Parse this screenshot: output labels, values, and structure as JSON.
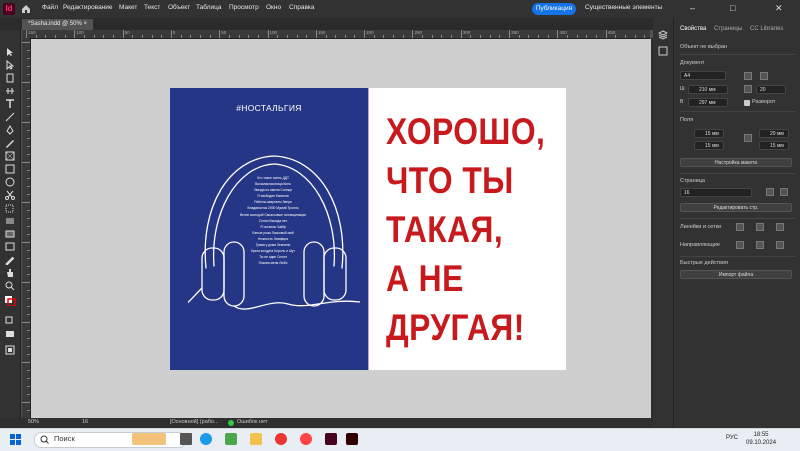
{
  "app": {
    "logo": "Id"
  },
  "menu": [
    "Файл",
    "Редактирование",
    "Макет",
    "Текст",
    "Объект",
    "Таблица",
    "Просмотр",
    "Окно",
    "Справка"
  ],
  "header": {
    "publish": "Публикация",
    "workspace": "Существенные элементы"
  },
  "document": {
    "tab": "*Sasha.indd @ 50%"
  },
  "ruler_labels": [
    "150",
    "100",
    "50",
    "0",
    "50",
    "100",
    "150",
    "200",
    "250",
    "300",
    "350",
    "400",
    "450"
  ],
  "page": {
    "hashtag": "#НОСТАЛЬГИЯ",
    "songs": [
      "Что такое осень ДДТ",
      "Восьмиклассница Кино",
      "Звезда по имени Солнце",
      "Я свободен Кипелов",
      "Районы-кварталы Звери",
      "Владивосток 2000 Мумий Тролль",
      "Вечно молодой Смысловые галлюцинации",
      "Сплин Выхода нет",
      "Я остаюсь Чайф",
      "Белые розы Ласковый май",
      "Нежность Земфира",
      "Трава у дома Земляне",
      "Кукла колдуна Король и Шут",
      "Ты не один Сплин",
      "Позови меня Любэ"
    ],
    "headline": [
      "ХОРОШО,",
      "ЧТО ТЫ",
      "ТАКАЯ,",
      "А НЕ",
      "ДРУГАЯ!"
    ],
    "colors": {
      "left_bg": "#263686",
      "headline": "#c8191d"
    }
  },
  "status": {
    "zoom": "50%",
    "page": "16",
    "state": "[Основной] (рабо...",
    "errors": "Ошибок нет"
  },
  "panel": {
    "tabs": [
      "Свойства",
      "Страницы",
      "CC Libraries"
    ],
    "selection": "Объект не выбран",
    "doc_section": "Документ",
    "preset": "А4",
    "width": "210 мм",
    "height": "297 мм",
    "pages_count": "20",
    "facing": "Разворот",
    "margins_section": "Поля",
    "margin_top": "15 мм",
    "margin_bottom": "15 мм",
    "margin_left": "20 мм",
    "margin_right": "15 мм",
    "layout_btn": "Настройка макета",
    "page_section": "Страница",
    "page_num": "16",
    "edit_page_btn": "Редактировать стр.",
    "guides_section": "Линейки и сетки",
    "align_section": "Направляющие",
    "quick_section": "Быстрые действия",
    "import_btn": "Импорт файла"
  },
  "taskbar": {
    "search": "Поиск",
    "lang": "РУС",
    "time": "18:55",
    "date": "09.10.2024"
  }
}
